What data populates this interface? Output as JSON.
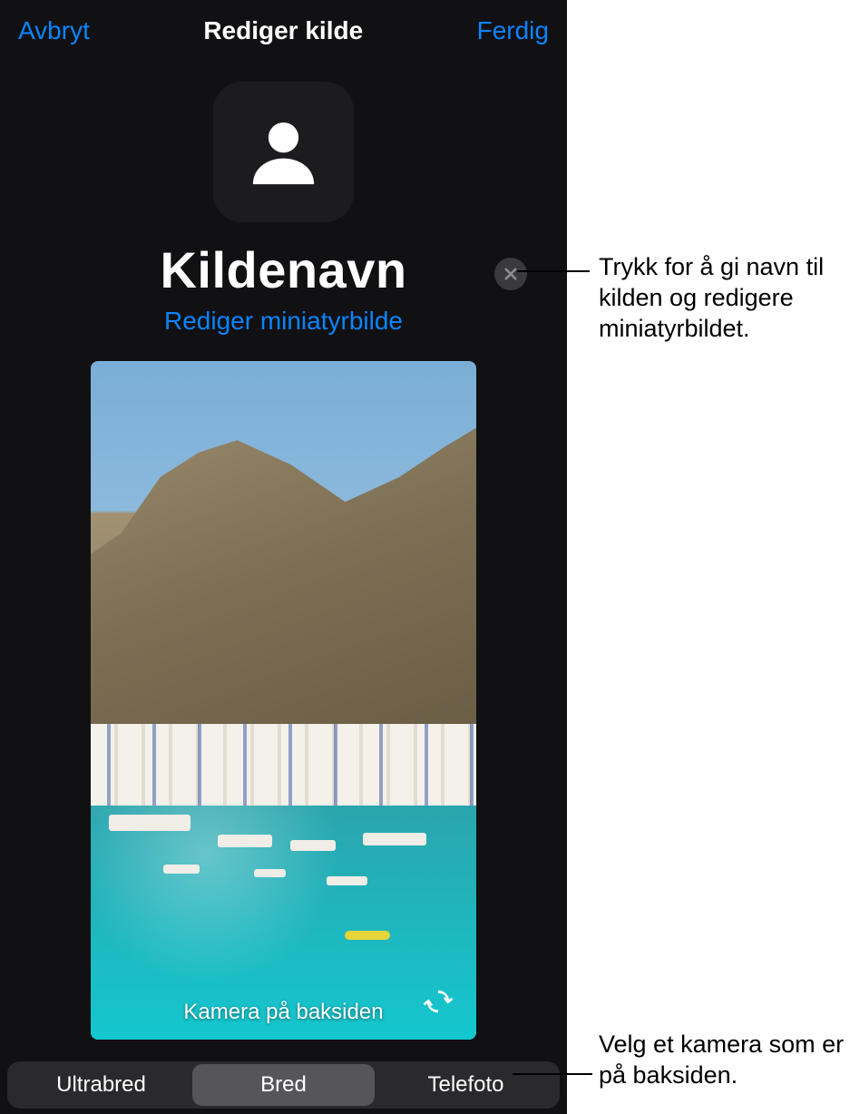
{
  "nav": {
    "cancel": "Avbryt",
    "title": "Rediger kilde",
    "done": "Ferdig"
  },
  "source": {
    "name": "Kildenavn",
    "edit_thumbnail": "Rediger miniatyrbilde"
  },
  "preview": {
    "camera_label": "Kamera på baksiden"
  },
  "segments": {
    "ultrawide": "Ultrabred",
    "wide": "Bred",
    "telephoto": "Telefoto",
    "active": "wide"
  },
  "annotations": {
    "rename": "Trykk for å gi navn til kilden og redigere miniatyrbildet.",
    "camera": "Velg et kamera som er på baksiden."
  }
}
